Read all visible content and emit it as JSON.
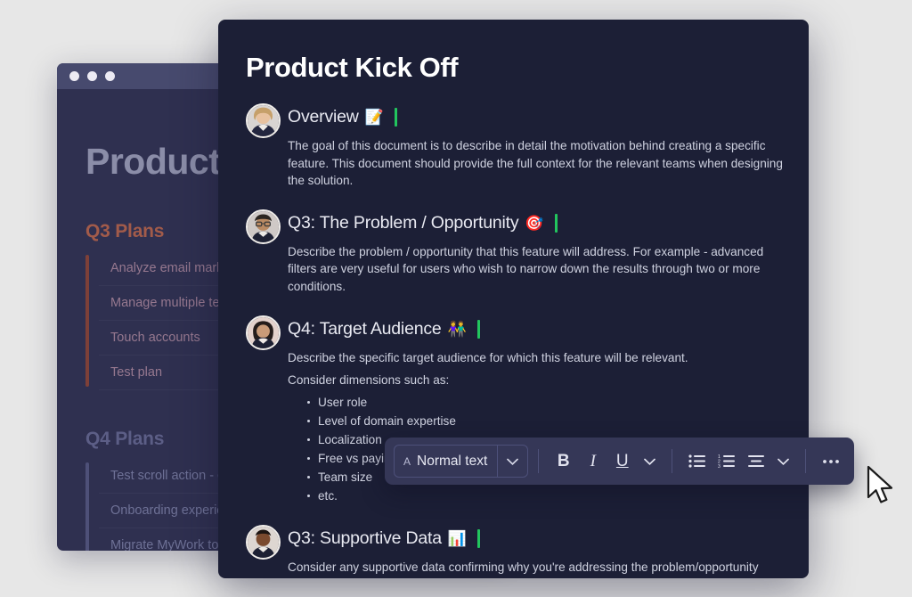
{
  "colors": {
    "page_background": "#e7e7e7",
    "back_window_background": "#2f3050",
    "back_window_titlebar": "#474a6e",
    "doc_panel_background": "#1c1f36",
    "toolbar_background": "#353757",
    "caret_green": "#22c55e",
    "q3_accent": "#a25b4a",
    "q4_accent": "#5c5e86"
  },
  "back_window": {
    "traffic_lights": [
      "window-dot-1",
      "window-dot-2",
      "window-dot-3"
    ],
    "title": "Product",
    "sections": [
      {
        "heading": "Q3 Plans",
        "items": [
          "Analyze email marke",
          "Manage multiple tea",
          "Touch accounts",
          "Test plan"
        ]
      },
      {
        "heading": "Q4 Plans",
        "items": [
          "Test scroll action - de",
          "Onboarding experien",
          "Migrate MyWork to n"
        ]
      }
    ]
  },
  "document": {
    "title": "Product Kick Off",
    "blocks": [
      {
        "avatar": "avatar-blonde-woman",
        "heading": "Overview",
        "emoji": "📝",
        "emoji_name": "memo-emoji",
        "paragraphs": [
          "The goal of this document is to describe in detail the motivation behind creating a specific feature. This document should provide the full context for the relevant teams when designing the solution."
        ],
        "bullets": []
      },
      {
        "avatar": "avatar-man-glasses",
        "heading": "Q3: The Problem / Opportunity",
        "emoji": "🎯",
        "emoji_name": "dart-emoji",
        "paragraphs": [
          "Describe the problem / opportunity that this feature will address. For example - advanced filters are very useful for users who wish to narrow down the results through two or more conditions."
        ],
        "bullets": []
      },
      {
        "avatar": "avatar-dark-haired-woman",
        "heading": "Q4: Target Audience",
        "emoji": "👫",
        "emoji_name": "two-people-emoji",
        "paragraphs": [
          "Describe the specific target audience for which this feature will be relevant.",
          "Consider dimensions such as:"
        ],
        "bullets": [
          "User role",
          "Level of domain expertise",
          "Localization",
          "Free vs paying ",
          "Team size",
          "etc."
        ]
      },
      {
        "avatar": "avatar-dark-skin-person",
        "heading": "Q3: Supportive Data",
        "emoji": "📊",
        "emoji_name": "bar-chart-emoji",
        "paragraphs": [
          "Consider any supportive data confirming why you're addressing the problem/opportunity"
        ],
        "bullets": []
      }
    ]
  },
  "toolbar": {
    "style_glyph": "A",
    "style_label": "Normal text",
    "style_chevron": "⌄",
    "bold_label": "B",
    "italic_label": "I",
    "underline_label": "U",
    "format_chevron": "⌄",
    "align_chevron": "⌄",
    "more_label": "···",
    "icons": [
      "bulleted-list-icon",
      "numbered-list-icon",
      "align-icon",
      "chevron-down-icon",
      "more-options-icon"
    ]
  }
}
